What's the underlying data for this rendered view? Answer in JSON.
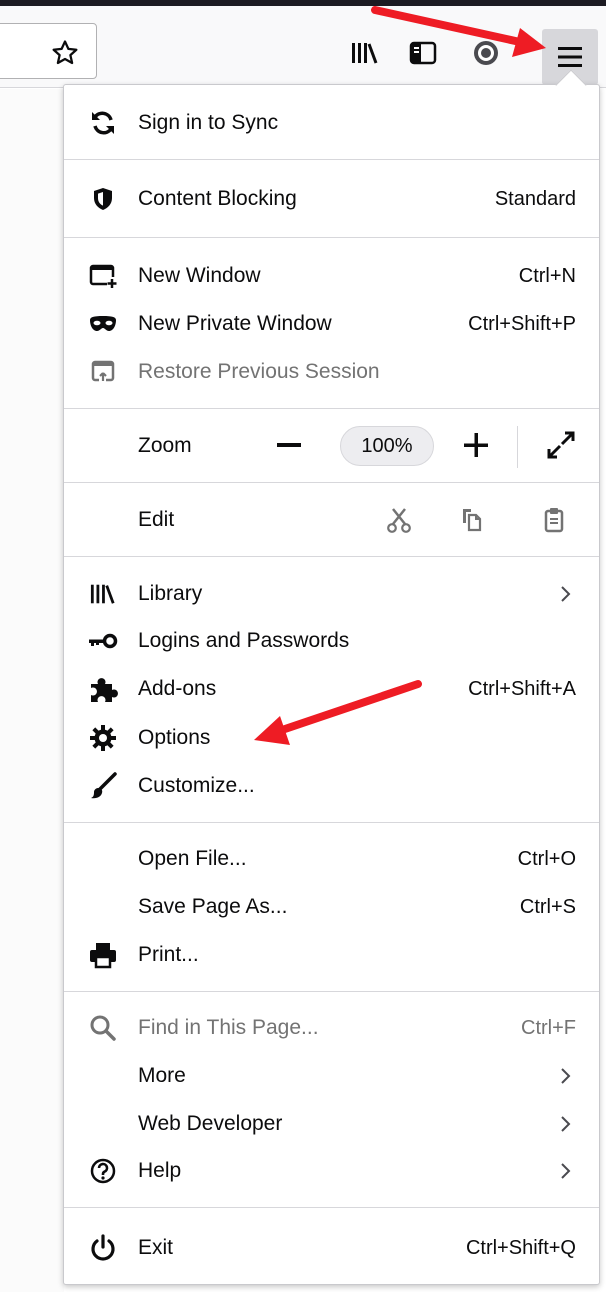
{
  "toolbar": {
    "icons": [
      "star-icon",
      "library-icon",
      "sidebar-icon",
      "account-icon",
      "hamburger-menu-icon"
    ]
  },
  "menu": {
    "sign_in": "Sign in to Sync",
    "content_blocking": {
      "label": "Content Blocking",
      "value": "Standard"
    },
    "new_window": {
      "label": "New Window",
      "shortcut": "Ctrl+N"
    },
    "new_private_window": {
      "label": "New Private Window",
      "shortcut": "Ctrl+Shift+P"
    },
    "restore_session": {
      "label": "Restore Previous Session"
    },
    "zoom": {
      "label": "Zoom",
      "level": "100%"
    },
    "edit": {
      "label": "Edit"
    },
    "library": {
      "label": "Library"
    },
    "logins": {
      "label": "Logins and Passwords"
    },
    "addons": {
      "label": "Add-ons",
      "shortcut": "Ctrl+Shift+A"
    },
    "options": {
      "label": "Options"
    },
    "customize": {
      "label": "Customize..."
    },
    "open_file": {
      "label": "Open File...",
      "shortcut": "Ctrl+O"
    },
    "save_page": {
      "label": "Save Page As...",
      "shortcut": "Ctrl+S"
    },
    "print": {
      "label": "Print..."
    },
    "find": {
      "label": "Find in This Page...",
      "shortcut": "Ctrl+F"
    },
    "more": {
      "label": "More"
    },
    "web_developer": {
      "label": "Web Developer"
    },
    "help": {
      "label": "Help"
    },
    "exit": {
      "label": "Exit",
      "shortcut": "Ctrl+Shift+Q"
    }
  },
  "annotations": {
    "arrow_color": "#ee1c24"
  },
  "colors": {
    "toolbar_bg": "#f9f9fa",
    "menu_button_active": "#d7d7db",
    "disabled_text": "#737373"
  }
}
